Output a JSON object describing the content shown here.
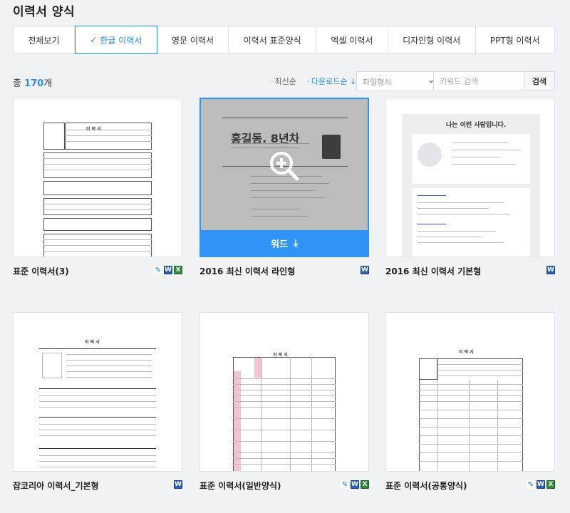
{
  "page": {
    "title": "이력서 양식"
  },
  "tabs": [
    {
      "label": "전체보기",
      "active": false
    },
    {
      "label": "한글 이력서",
      "active": true
    },
    {
      "label": "영문 이력서",
      "active": false
    },
    {
      "label": "이력서 표준양식",
      "active": false
    },
    {
      "label": "엑셀 이력서",
      "active": false
    },
    {
      "label": "디자인형 이력서",
      "active": false
    },
    {
      "label": "PPT형 이력서",
      "active": false
    }
  ],
  "toolbar": {
    "count_prefix": "총 ",
    "count_value": "170",
    "count_suffix": "개",
    "sort_latest": "최신순",
    "sort_download": "다운로드순 ↓",
    "filetype_select": "파일형식",
    "search_placeholder": "키워드 검색",
    "search_button": "검색"
  },
  "cards": [
    {
      "title": "표준 이력서(3)",
      "formats": [
        "hwp",
        "word",
        "excel"
      ]
    },
    {
      "title": "2016 최신 이력서 라인형",
      "formats": [
        "word"
      ],
      "hover_label": "워드",
      "preview_name": "홍길동. 8년차"
    },
    {
      "title": "2016 최신 이력서 기본형",
      "formats": [
        "word"
      ],
      "preview_heading": "나는 이런 사람입니다."
    },
    {
      "title": "잡코리아 이력서_기본형",
      "formats": [
        "word"
      ]
    },
    {
      "title": "표준 이력서(일반양식)",
      "formats": [
        "hwp",
        "word",
        "excel"
      ]
    },
    {
      "title": "표준 이력서(공통양식)",
      "formats": [
        "hwp",
        "word",
        "excel"
      ]
    }
  ],
  "preview_texts": {
    "resume_title": "이 력 서"
  },
  "colors": {
    "accent": "#2a8bf2",
    "download_bar": "#2f94f5",
    "pink_cells": "#f3c3d6"
  }
}
